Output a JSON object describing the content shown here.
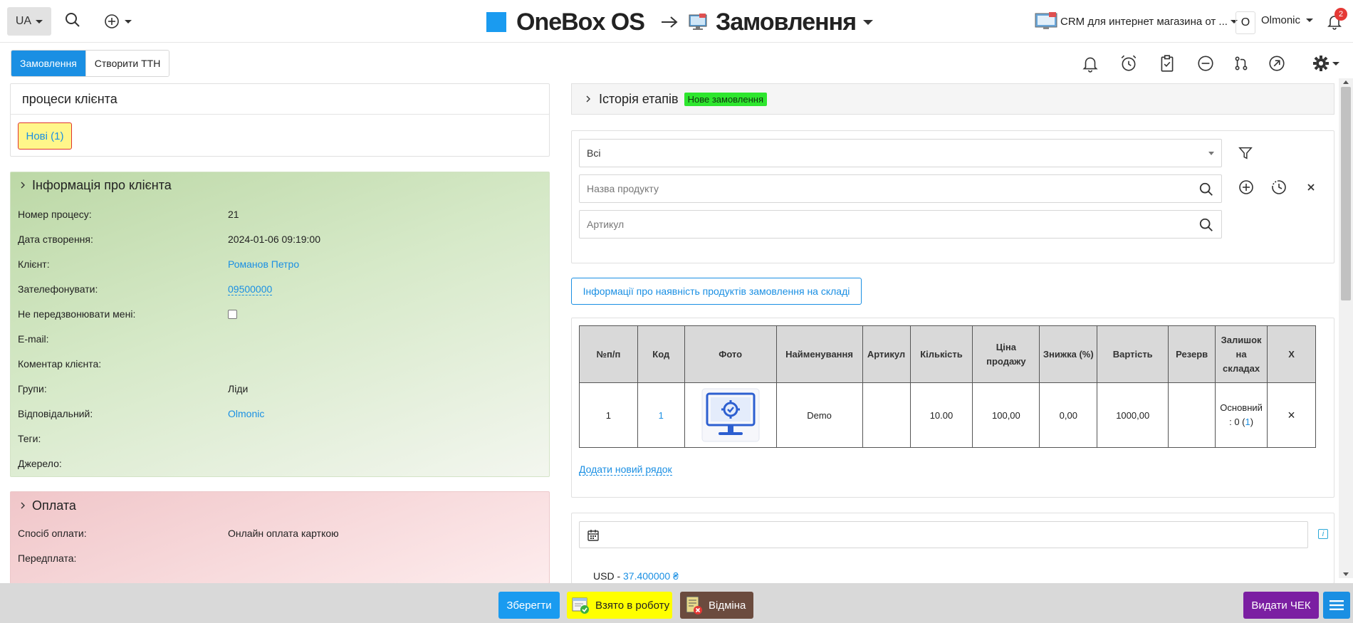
{
  "topbar": {
    "lang": "UA",
    "brand": "OneBox OS",
    "module": "Замовлення",
    "crm_select": "CRM для интернет магазина от ...",
    "user_initial": "O",
    "user_name": "Olmonic",
    "notif_count": "2"
  },
  "tabs": [
    {
      "label": "Замовлення",
      "active": true
    },
    {
      "label": "Створити ТТН",
      "active": false
    }
  ],
  "process_panel": {
    "title": "процеси клієнта",
    "new_button": "Нові (1)"
  },
  "client_info": {
    "title": "Інформація про клієнта",
    "rows": [
      {
        "label": "Номер процесу:",
        "value": "21"
      },
      {
        "label": "Дата створення:",
        "value": "2024-01-06 09:19:00"
      },
      {
        "label": "Клієнт:",
        "value": "Романов Петро"
      },
      {
        "label": "Зателефонувати:",
        "value": "09500000"
      },
      {
        "label": "Не передзвонювати мені:",
        "value": ""
      },
      {
        "label": "E-mail:",
        "value": ""
      },
      {
        "label": "Коментар клієнта:",
        "value": ""
      },
      {
        "label": "Групи:",
        "value": "Ліди"
      },
      {
        "label": "Відповідальний:",
        "value": "Olmonic"
      },
      {
        "label": "Теги:",
        "value": ""
      },
      {
        "label": "Джерело:",
        "value": ""
      }
    ]
  },
  "payment": {
    "title": "Оплата",
    "rows": [
      {
        "label": "Спосіб оплати:",
        "value": "Онлайн оплата карткою"
      },
      {
        "label": "Передплата:",
        "value": ""
      }
    ]
  },
  "history": {
    "title": "Історія етапів",
    "badge": "Нове замовлення",
    "badge_color": "#2ee62e"
  },
  "filters": {
    "status_value": "Всі",
    "product_placeholder": "Назва продукту",
    "article_placeholder": "Артикул"
  },
  "stock_button": "Інформації про наявність продуктів замовлення на складі",
  "order_table": {
    "headers": [
      "№п/п",
      "Код",
      "Фото",
      "Найменування",
      "Артикул",
      "Кількість",
      "Ціна продажу",
      "Знижка (%)",
      "Вартість",
      "Резерв",
      "Залишок на складах",
      "X"
    ],
    "rows": [
      {
        "num": "1",
        "code": "1",
        "name": "Demo",
        "article": "",
        "qty": "10.00",
        "price": "100,00",
        "discount": "0,00",
        "total": "1000,00",
        "reserve": "",
        "stock_prefix": "Основний : 0 (",
        "stock_link": "1",
        "stock_suffix": ")",
        "remove": "×"
      }
    ],
    "add_row": "Додати новий рядок"
  },
  "currency": {
    "label": "USD - ",
    "rate": "37.400000 ₴"
  },
  "bottom": {
    "save": "Зберегти",
    "in_work": "Взято в роботу",
    "cancel": "Відміна",
    "cheque": "Видати ЧЕК"
  },
  "colors": {
    "accent": "#1a8fe3",
    "client_panel": "#bcd8a6",
    "payment_panel": "#f0c6c9",
    "in_work": "#ffff00",
    "cancel": "#6b4b3e",
    "cheque": "#7b1fa2"
  }
}
